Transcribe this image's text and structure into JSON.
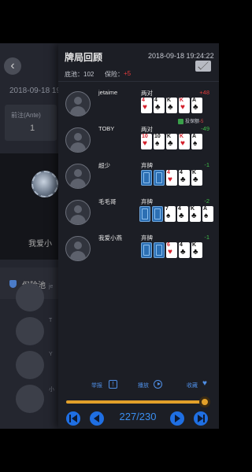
{
  "background": {
    "date": "2018-09-18 19",
    "ante_label": "前注(Ante)",
    "ante_value": "1",
    "player_name": "我爱小",
    "insurance_pool_label": "保险池",
    "list_snippets": [
      "je",
      "T",
      "Y",
      "小"
    ]
  },
  "panel": {
    "title": "牌局回顾",
    "timestamp": "2018-09-18 19:24:22",
    "pot_label": "底池：102",
    "insurance_label": "保险：",
    "insurance_value": "+5"
  },
  "players": [
    {
      "name": "jetaime",
      "hand": "两对",
      "delta": "+48",
      "delta_color": "#e03c3c",
      "cards": [
        {
          "r": "4",
          "s": "♥",
          "c": "red"
        },
        {
          "r": "4",
          "s": "♣",
          "c": "blk"
        },
        {
          "r": "K",
          "s": "♣",
          "c": "blk"
        },
        {
          "r": "K",
          "s": "♥",
          "c": "red"
        },
        {
          "r": "A",
          "s": "♣",
          "c": "blk"
        }
      ],
      "insurance_badge": {
        "label": "投保额",
        "value": "-5"
      }
    },
    {
      "name": "TOBY",
      "hand": "两对",
      "delta": "-49",
      "delta_color": "#3fbf4a",
      "cards": [
        {
          "r": "10",
          "s": "♥",
          "c": "red"
        },
        {
          "r": "10",
          "s": "♠",
          "c": "blk"
        },
        {
          "r": "K",
          "s": "♣",
          "c": "blk"
        },
        {
          "r": "K",
          "s": "♥",
          "c": "red"
        },
        {
          "r": "A",
          "s": "♠",
          "c": "blk"
        }
      ]
    },
    {
      "name": "超少",
      "hand": "弃牌",
      "delta": "-1",
      "delta_color": "#3fbf4a",
      "cards": [
        {
          "back": true
        },
        {
          "back": true
        },
        {
          "r": "4",
          "s": "♥",
          "c": "red"
        },
        {
          "r": "4",
          "s": "♣",
          "c": "blk"
        },
        {
          "r": "K",
          "s": "♣",
          "c": "blk"
        }
      ]
    },
    {
      "name": "毛毛哥",
      "hand": "弃牌",
      "delta": "-2",
      "delta_color": "#3fbf4a",
      "cards": [
        {
          "back": true
        },
        {
          "back": true
        },
        {
          "r": "7",
          "s": "♠",
          "c": "blk"
        },
        {
          "r": "4",
          "s": "♣",
          "c": "blk"
        },
        {
          "r": "K",
          "s": "♣",
          "c": "blk"
        },
        {
          "r": "A",
          "s": "♠",
          "c": "blk"
        }
      ]
    },
    {
      "name": "我爱小燕",
      "hand": "弃牌",
      "delta": "-1",
      "delta_color": "#3fbf4a",
      "cards": [
        {
          "back": true
        },
        {
          "back": true
        },
        {
          "r": "6",
          "s": "♥",
          "c": "red"
        },
        {
          "r": "4",
          "s": "♣",
          "c": "blk"
        },
        {
          "r": "K",
          "s": "♣",
          "c": "blk"
        }
      ]
    }
  ],
  "controls": {
    "report_label": "举报",
    "report_icon": "!",
    "play_label": "播放",
    "favorite_label": "收藏",
    "favorite_icon": "♥",
    "current": 227,
    "total": 230,
    "counter_text": "227/230",
    "accent_color": "#1f6fe3",
    "slider_color": "#e2a02a"
  }
}
